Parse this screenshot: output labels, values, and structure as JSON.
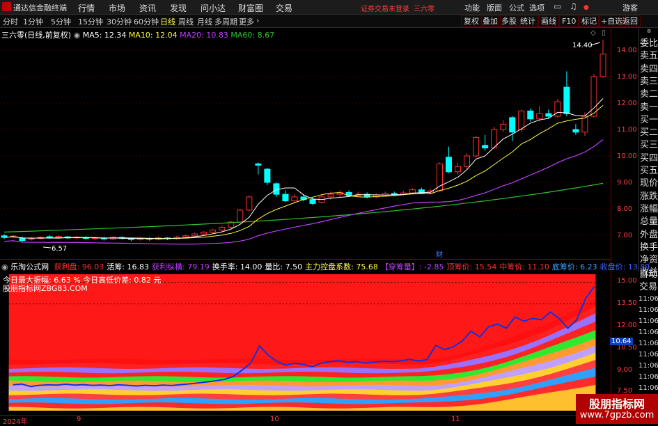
{
  "app": {
    "name": "通达信金融终端",
    "warning": "证券交易未登录",
    "stock_name": "三六零"
  },
  "menu": [
    "行情",
    "市场",
    "资讯",
    "发现",
    "问小达",
    "财富圈",
    "交易"
  ],
  "top_right": [
    "功能",
    "版面",
    "公式",
    "选项"
  ],
  "guest": "游客",
  "periods": [
    "分时",
    "1分钟",
    "5分钟",
    "15分钟",
    "30分钟",
    "60分钟",
    "日线",
    "周线",
    "月线",
    "多周期",
    "更多"
  ],
  "active_period": "日线",
  "right_tabs": [
    "复权",
    "叠加",
    "多股",
    "统计",
    "画线",
    "F10",
    "标记",
    "+自选",
    "返回"
  ],
  "main_legend": {
    "title": "三六零(日线,前复权)",
    "ma5": "MA5: 12.34",
    "ma10": "MA10: 12.04",
    "ma20": "MA20: 10.83",
    "ma60": "MA60: 8.67"
  },
  "annotations": {
    "high": "14.40",
    "low": "6.57",
    "cai": "财"
  },
  "price_ticks": [
    "14.00",
    "13.00",
    "12.00",
    "11.00",
    "10.00",
    "9.00",
    "8.00",
    "7.00"
  ],
  "sub_ticks": [
    "15.00",
    "13.50",
    "12.00",
    "10.50",
    "9.00",
    "7.50"
  ],
  "sub_highlight": "10.64",
  "side_labels": [
    "委比",
    "卖五",
    "卖四",
    "卖三",
    "卖二",
    "卖一",
    "买一",
    "买二",
    "买三",
    "买四",
    "买五",
    "现价",
    "涨跌",
    "涨幅",
    "总量",
    "外盘",
    "换手",
    "净资",
    "收益"
  ],
  "side_labels2": [
    "自动",
    "交易"
  ],
  "side_ticker": [
    "11:06",
    "11:06",
    "11:06",
    "11:06",
    "11:06",
    "11:06",
    "11:06",
    "11:06",
    "11:06",
    "11:06",
    "11:06",
    "11:06"
  ],
  "sub_legend": {
    "name": "乐淘公式网",
    "items": [
      {
        "label": "获利盘: 96.03",
        "color": "#ff3030"
      },
      {
        "label": "活筹: 16.83",
        "color": "#ffffff"
      },
      {
        "label": "获利纵横: 79.19",
        "color": "#c040ff"
      },
      {
        "label": "换手率: 14.00",
        "color": "#ffffff"
      },
      {
        "label": "量比: 7.50",
        "color": "#ffffff"
      },
      {
        "label": "主力控盘系数: 75.68",
        "color": "#ffff40"
      },
      {
        "label": "【穿筹量】: -2.85",
        "color": "#c040ff"
      },
      {
        "label": "顶筹价: 15.54",
        "color": "#ff3030"
      },
      {
        "label": "中筹价: 11.10",
        "color": "#ff3030"
      },
      {
        "label": "底筹价: 6.23",
        "color": "#40a0ff"
      },
      {
        "label": "收盘价: 13.89",
        "color": "#4060ff"
      }
    ]
  },
  "sub_text1": "今日最大振幅: 6.63 %    今日高低价差: 0.82 元",
  "sub_text2": "股朋指标网ZBG83.COM",
  "dates": [
    "2024年",
    "9",
    "10",
    "11"
  ],
  "watermark": {
    "line1": "股朋指标网",
    "line2": "www.7gpzb.com"
  },
  "colors": {
    "up": "#ff3030",
    "down": "#00ffff",
    "ma5": "#ffffff",
    "ma10": "#ffff40",
    "ma20": "#c040ff",
    "ma60": "#30c030"
  }
}
